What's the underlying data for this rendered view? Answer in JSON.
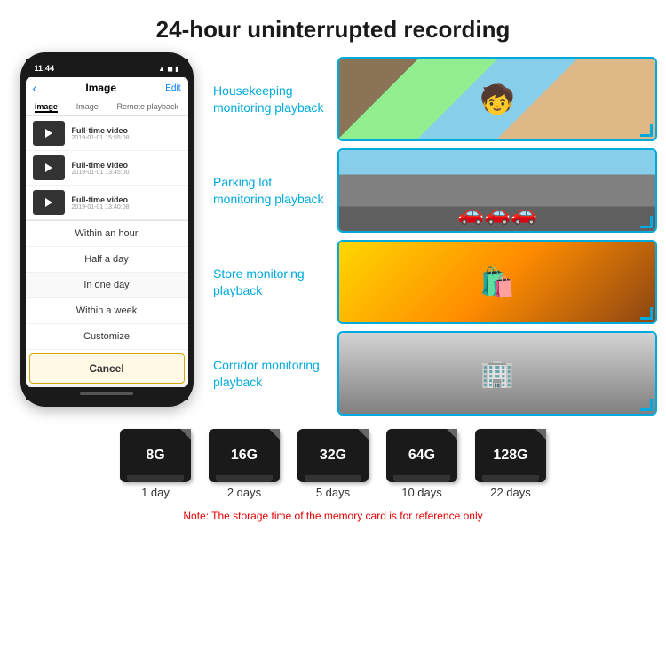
{
  "header": {
    "title": "24-hour uninterrupted recording"
  },
  "phone": {
    "time": "11:44",
    "status_icons": "▲ ◼ ▮",
    "back": "‹",
    "screen_title": "Image",
    "edit": "Edit",
    "tabs": [
      "image",
      "Image",
      "Remote playback"
    ],
    "videos": [
      {
        "name": "Full-time video",
        "date": "2019-01-01 15:55:08"
      },
      {
        "name": "Full-time video",
        "date": "2019-01-01 13:45:00"
      },
      {
        "name": "Full-time video",
        "date": "2019-01-01 13:40:08"
      }
    ],
    "dropdown_items": [
      "Within an hour",
      "Half a day",
      "In one day",
      "Within a week",
      "Customize"
    ],
    "cancel_label": "Cancel"
  },
  "monitoring": [
    {
      "label_line1": "Housekeeping",
      "label_line2": "monitoring playback",
      "emoji": "🧒"
    },
    {
      "label_line1": "Parking lot",
      "label_line2": "monitoring playback",
      "emoji": "🚗"
    },
    {
      "label_line1": "Store monitoring",
      "label_line2": "playback",
      "emoji": "🛍️"
    },
    {
      "label_line1": "Corridor monitoring",
      "label_line2": "playback",
      "emoji": "🏢"
    }
  ],
  "storage": {
    "cards": [
      {
        "size": "8G",
        "days": "1 day"
      },
      {
        "size": "16G",
        "days": "2 days"
      },
      {
        "size": "32G",
        "days": "5 days"
      },
      {
        "size": "64G",
        "days": "10 days"
      },
      {
        "size": "128G",
        "days": "22 days"
      }
    ],
    "note": "Note: The storage time of the memory card is for reference only"
  }
}
